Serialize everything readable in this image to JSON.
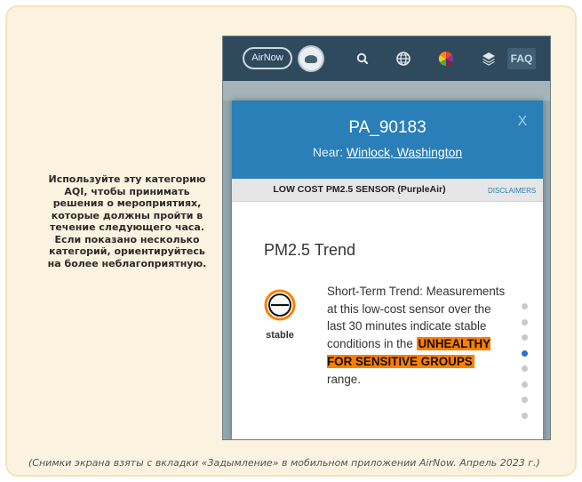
{
  "instruction_text": "Используйте эту категорию AQI, чтобы принимать решения о мероприятиях, которые должны пройти в течение следующего часа. Если показано несколько категорий, ориентируйтесь на более неблагоприятную.",
  "caption": "(Снимки экрана взяты с вкладки «Задымление» в мобильном приложении AirNow. Апрель 2023 г.)",
  "app_bar": {
    "logo_text": "AirNow",
    "faq_label": "FAQ",
    "icons": [
      "search-icon",
      "globe-icon",
      "color-wheel-icon",
      "layers-icon"
    ]
  },
  "modal": {
    "sensor_id": "PA_90183",
    "near_prefix": "Near: ",
    "near_location": "Winlock, Washington",
    "close_label": "X",
    "sensor_type": "LOW COST PM2.5 SENSOR (PurpleAir)",
    "disclaimers_label": "DISCLAIMERS",
    "trend_heading": "PM2.5 Trend",
    "trend_icon_label": "stable",
    "trend_text_before": "Short-Term Trend: Measurements at this low-cost sensor over the last 30 minutes indicate stable conditions in the",
    "aqi_category": "UNHEALTHY FOR SENSITIVE GROUPS",
    "trend_text_after": "range.",
    "pager": {
      "count": 8,
      "active_index": 3
    }
  },
  "colors": {
    "app_bar": "#2f4a5d",
    "modal_header": "#2a7fb8",
    "aqi_orange": "#ff7e00",
    "card_background": "#fbf3df"
  }
}
